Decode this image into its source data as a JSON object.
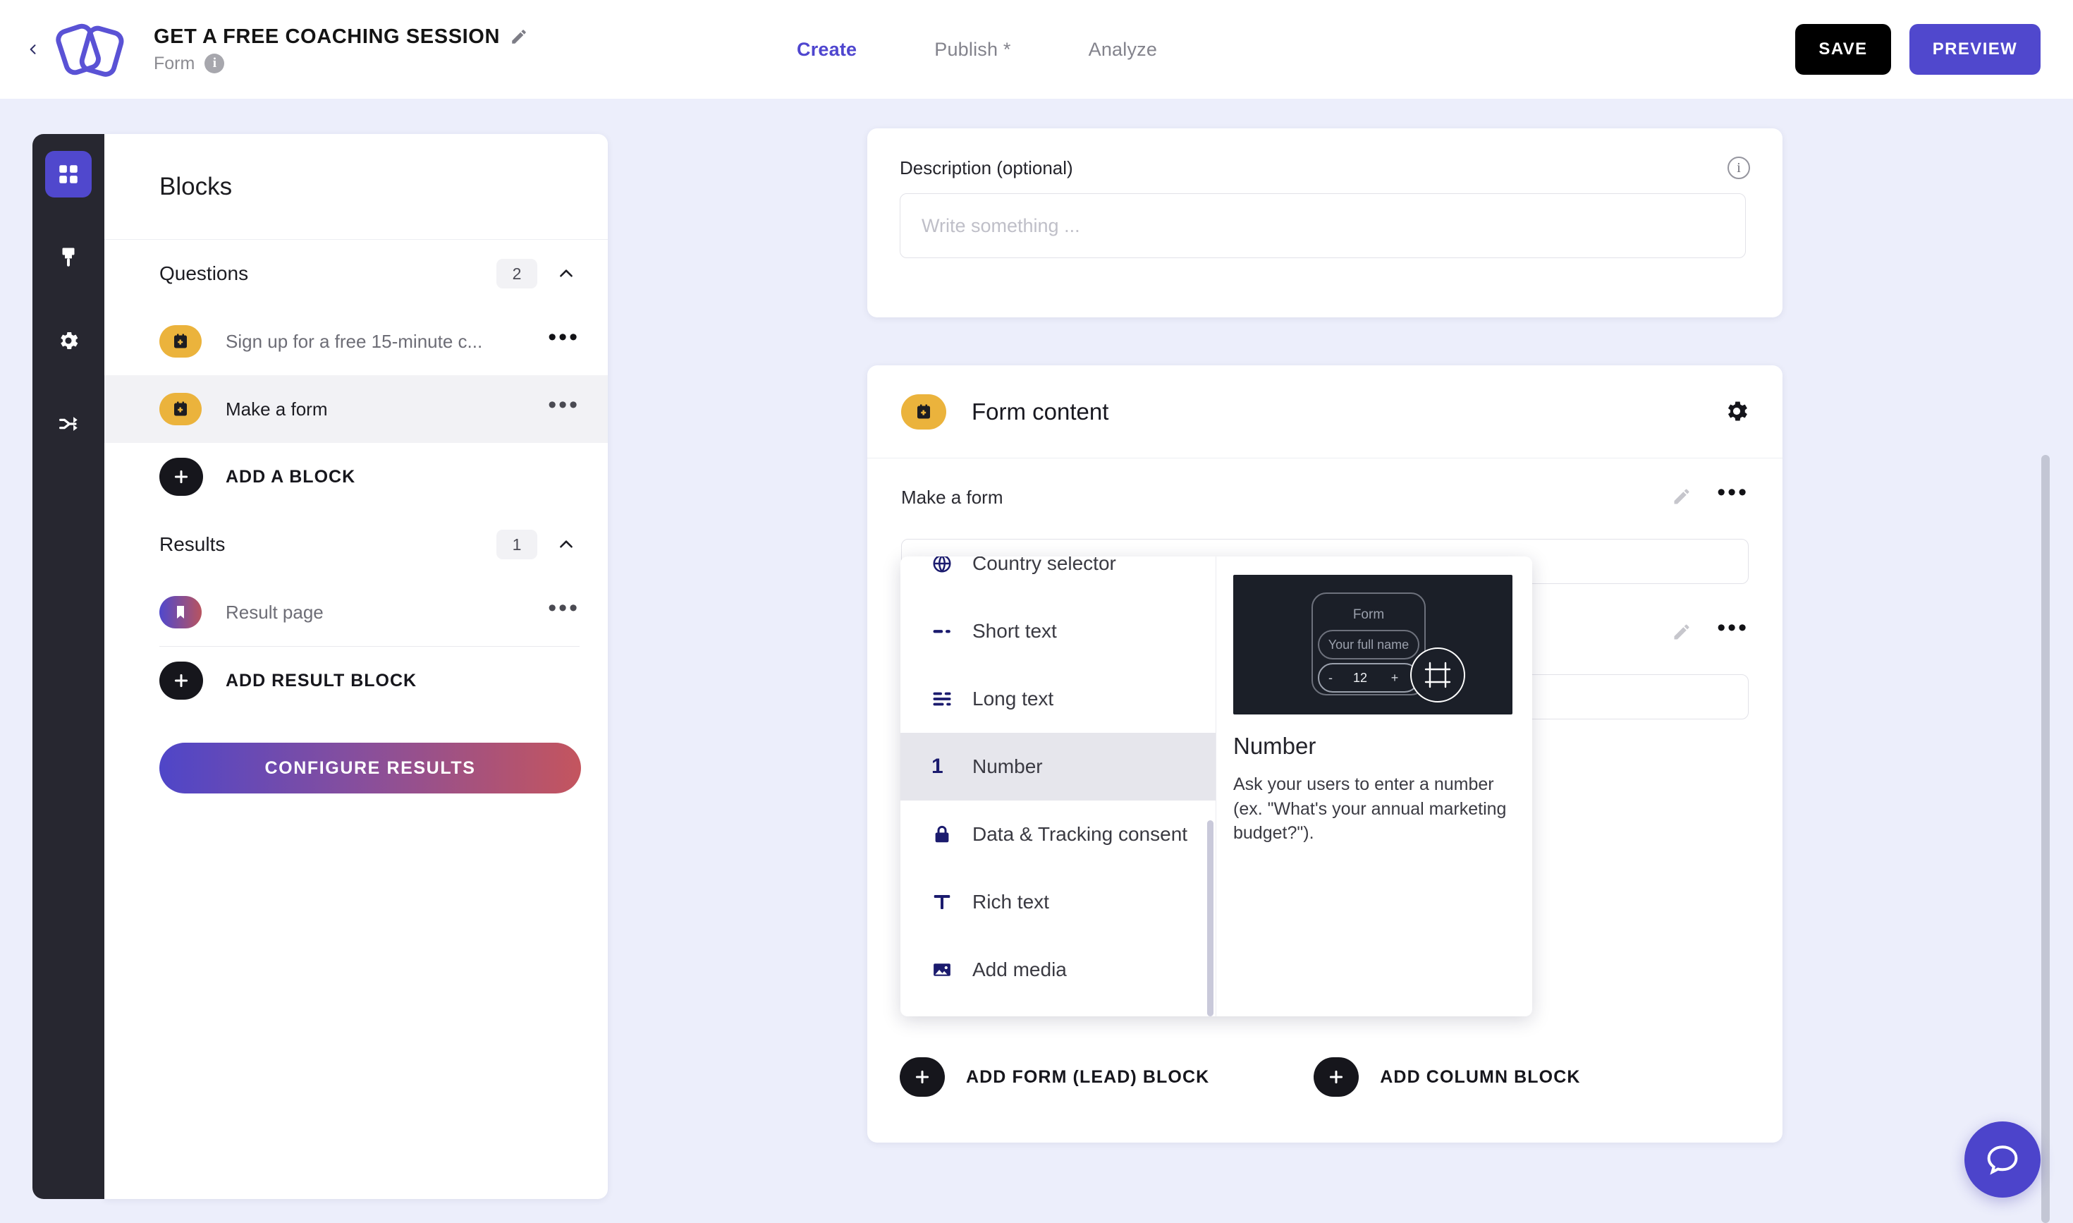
{
  "header": {
    "back_icon": "chevron-left-icon",
    "logo_icon": "brand-logo-icon",
    "form_title": "GET A FREE COACHING SESSION",
    "edit_icon": "pencil-icon",
    "form_subtype": "Form",
    "info_icon": "info-icon",
    "tabs": [
      {
        "label": "Create",
        "active": true
      },
      {
        "label": "Publish *",
        "active": false
      },
      {
        "label": "Analyze",
        "active": false
      }
    ],
    "save_label": "SAVE",
    "preview_label": "PREVIEW"
  },
  "rail": {
    "items": [
      {
        "icon": "blocks-grid-icon",
        "active": true
      },
      {
        "icon": "paintbrush-icon",
        "active": false
      },
      {
        "icon": "gear-icon",
        "active": false
      },
      {
        "icon": "share-nodes-icon",
        "active": false
      }
    ]
  },
  "blocks_panel": {
    "title": "Blocks",
    "questions": {
      "label": "Questions",
      "count": "2",
      "collapse_icon": "chevron-up-icon",
      "items": [
        {
          "label": "Sign up for a free 15-minute c...",
          "icon": "form-block-icon",
          "selected": false,
          "menu_icon": "ellipsis-icon"
        },
        {
          "label": "Make a form",
          "icon": "form-block-icon",
          "selected": true,
          "menu_icon": "ellipsis-icon"
        }
      ],
      "add_label": "ADD A BLOCK",
      "add_icon": "plus-icon"
    },
    "results": {
      "label": "Results",
      "count": "1",
      "collapse_icon": "chevron-up-icon",
      "items": [
        {
          "label": "Result page",
          "icon": "bookmark-icon",
          "menu_icon": "ellipsis-icon"
        }
      ],
      "add_label": "ADD RESULT BLOCK",
      "add_icon": "plus-icon"
    },
    "configure_label": "CONFIGURE RESULTS"
  },
  "description_card": {
    "label": "Description (optional)",
    "info_icon": "info-outline-icon",
    "input_value": "",
    "placeholder": "Write something ..."
  },
  "content_card": {
    "icon": "form-block-icon",
    "title": "Form content",
    "settings_icon": "gear-icon",
    "subtitle": "Make a form",
    "fields": [
      {
        "edit_icon": "pencil-icon",
        "menu_icon": "ellipsis-icon",
        "value": ""
      },
      {
        "edit_icon": "pencil-icon",
        "menu_icon": "ellipsis-icon",
        "value": ""
      }
    ],
    "footer": [
      {
        "label": "ADD FORM (LEAD) BLOCK",
        "icon": "plus-icon"
      },
      {
        "label": "ADD COLUMN BLOCK",
        "icon": "plus-icon"
      }
    ]
  },
  "dropdown": {
    "items": [
      {
        "label": "Country selector",
        "icon": "globe-icon",
        "highlight": false
      },
      {
        "label": "Short text",
        "icon": "short-text-icon",
        "highlight": false
      },
      {
        "label": "Long text",
        "icon": "long-text-icon",
        "highlight": false
      },
      {
        "label": "Number",
        "icon": "number-one-icon",
        "highlight": true
      },
      {
        "label": "Data & Tracking consent",
        "icon": "lock-icon",
        "highlight": false
      },
      {
        "label": "Rich text",
        "icon": "text-t-icon",
        "highlight": false
      },
      {
        "label": "Add media",
        "icon": "image-icon",
        "highlight": false
      }
    ],
    "preview": {
      "title": "Number",
      "description": "Ask your users to enter a number  (ex. \"What's your annual marketing budget?\").",
      "thumb": {
        "form_label": "Form",
        "name_placeholder": "Your full name",
        "stepper_minus": "-",
        "stepper_value": "12",
        "stepper_plus": "+",
        "hash_icon": "hash-icon"
      }
    }
  },
  "chat": {
    "icon": "chat-bubble-icon"
  },
  "colors": {
    "page_bg": "#eceefb",
    "accent_purple": "#5048cd",
    "rail_dark": "#272730",
    "block_yellow": "#ebb33c",
    "gradient_start": "#4f46c8",
    "gradient_end": "#c4555e",
    "dropdown_icon_navy": "#1b1b6e"
  }
}
